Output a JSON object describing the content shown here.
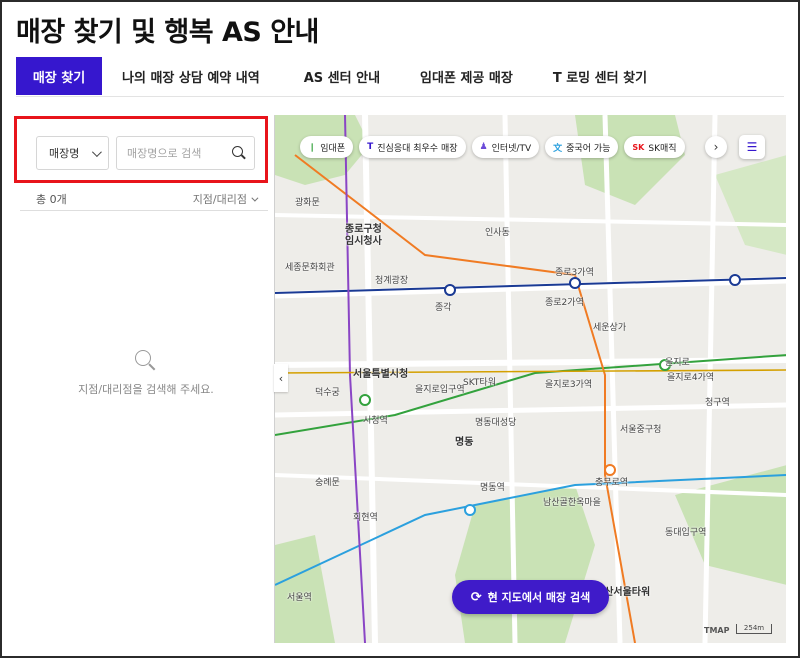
{
  "page": {
    "title": "매장 찾기 및 행복 AS 안내"
  },
  "tabs": [
    {
      "label": "매장 찾기",
      "active": true
    },
    {
      "label": "나의 매장 상담 예약 내역",
      "active": false
    },
    {
      "label": "AS 센터 안내",
      "active": false
    },
    {
      "label": "임대폰 제공 매장",
      "active": false
    },
    {
      "label": "T 로밍 센터 찾기",
      "active": false
    }
  ],
  "search": {
    "select_value": "매장명",
    "placeholder": "매장명으로 검색",
    "value": ""
  },
  "results": {
    "count_label": "총 0개",
    "filter_label": "지점/대리점",
    "empty_message": "지점/대리점을 검색해 주세요."
  },
  "map": {
    "chips": [
      {
        "icon": "ㅣ",
        "label": "임대폰"
      },
      {
        "icon": "T",
        "label": "진심응대 최우수 매장"
      },
      {
        "icon": "♟",
        "label": "인터넷/TV"
      },
      {
        "icon": "文",
        "label": "중국어 가능"
      },
      {
        "icon": "SK",
        "label": "SK매직"
      }
    ],
    "search_button_label": "현 지도에서 매장 검색",
    "logo": "TMAP",
    "scale_label": "254m",
    "labels": [
      "종로구청",
      "임시청사",
      "세종문화회관",
      "광화문",
      "종각",
      "종로3가역",
      "종로2가역",
      "서울특별시청",
      "을지로입구역",
      "을지로3가역",
      "을지로4가역",
      "명동역",
      "명동",
      "서울중구청",
      "회현역",
      "남산서울타워",
      "SKT타워",
      "서울역",
      "덕수궁",
      "시청역",
      "청계광장",
      "인사동",
      "세운상가",
      "충무로역",
      "을지로",
      "명동대성당",
      "숭례문",
      "남산골한옥마을",
      "동대입구역",
      "청구역"
    ],
    "colors": {
      "park": "#c9e2b5",
      "road": "#ffffff",
      "line1": "#1a3a94",
      "line2": "#33a23d",
      "line3": "#f07b23",
      "line4": "#2ba0de",
      "line5": "#8a45c5"
    }
  },
  "colors": {
    "accent": "#3617ce",
    "highlight": "#e8141b"
  }
}
